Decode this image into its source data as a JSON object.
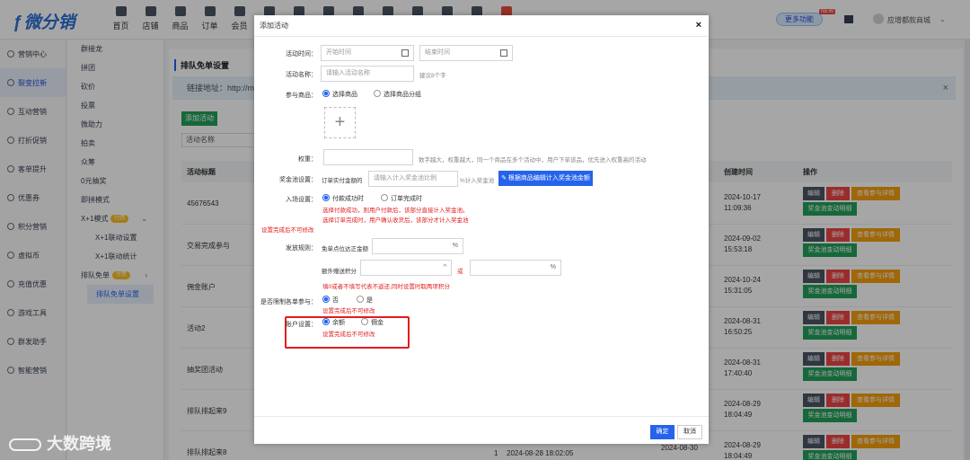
{
  "app": {
    "logo": "微分销"
  },
  "topnav": [
    {
      "label": "首页",
      "icon": "home-icon"
    },
    {
      "label": "店铺",
      "icon": "shop-icon"
    },
    {
      "label": "商品",
      "icon": "goods-icon"
    },
    {
      "label": "订单",
      "icon": "order-icon"
    },
    {
      "label": "会员",
      "icon": "member-icon"
    },
    {
      "label": "",
      "icon": "apps-icon"
    },
    {
      "label": "",
      "icon": "gift-icon"
    },
    {
      "label": "",
      "icon": "chart-icon"
    },
    {
      "label": "",
      "icon": "gear-icon"
    },
    {
      "label": "",
      "icon": "share-icon"
    },
    {
      "label": "",
      "icon": "compass-icon"
    },
    {
      "label": "",
      "icon": "graduation-icon"
    },
    {
      "label": "",
      "icon": "pie-icon"
    },
    {
      "label": "",
      "icon": "badge-icon"
    }
  ],
  "header": {
    "more": "更多功能",
    "new_badge": "NEW",
    "user": "应增都款商城"
  },
  "sidebar": [
    "营销中心",
    "裂变拉新",
    "互动营销",
    "打折促销",
    "客单提升",
    "优惠券",
    "积分营销",
    "虚拟币",
    "充值优惠",
    "游戏工具",
    "群发助手",
    "智能营销"
  ],
  "sidebar_active": 1,
  "subnav": {
    "items": [
      "群接龙",
      "拼团",
      "砍价",
      "投票",
      "微助力",
      "拍卖",
      "众筹",
      "0元抽奖",
      "即拼模式"
    ],
    "x1": "X+1模式",
    "x1_tag": "付费",
    "x1_children": [
      "X+1联动设置",
      "X+1联动统计"
    ],
    "queue": "排队免单",
    "queue_tag": "付费",
    "queue_child": "排队免单设置"
  },
  "main": {
    "title": "排队免单设置",
    "link_label": "链接地址：http://m",
    "add_button": "添加活动",
    "search_placeholder": "活动名称",
    "columns": {
      "title": "活动标题",
      "created": "创建时间",
      "ops": "操作"
    },
    "ops": {
      "edit": "编辑",
      "delete": "删除",
      "view": "查看参与详情",
      "detail": "奖金池变动明细"
    },
    "rows": [
      {
        "title": "45676543",
        "date": "2024-10-17",
        "time": "11:09:36"
      },
      {
        "title": "交易完成参与",
        "date": "2024-09-02",
        "time": "15:53:18"
      },
      {
        "title": "佣金账户",
        "date": "2024-10-24",
        "time": "15:31:05"
      },
      {
        "title": "活动2",
        "date": "2024-08-31",
        "time": "16:50:25"
      },
      {
        "title": "抽奖团活动",
        "date": "2024-08-31",
        "time": "17:40:40"
      },
      {
        "title": "排队排起来9",
        "date": "2024-08-29",
        "time": "18:04:49"
      },
      {
        "title": "排队排起来8",
        "date": "2024-08-29",
        "time": "18:04:49",
        "extra_count": "1",
        "extra_start": "2024-08-28 18:02:05",
        "extra_end": "2024-08-30"
      }
    ]
  },
  "modal": {
    "title": "添加活动",
    "close": "×",
    "fields": {
      "time_label": "活动时间：",
      "start_ph": "开始时间",
      "end_ph": "结束时间",
      "name_label": "活动名称：",
      "name_ph": "请输入活动名称",
      "name_hint": "建议8个字",
      "goods_label": "参与商品：",
      "goods_opt1": "选择商品",
      "goods_opt2": "选择商品分组",
      "upload_plus": "+",
      "weight_label": "权重：",
      "weight_hint": "数字越大，权重越大，同一个商品在多个活动中，用户下单该品，优先进入权重高的活动",
      "pool_label": "奖金池设置：",
      "pool_prefix": "订单实付金额的",
      "pool_ph": "请输入计入奖金池比例",
      "pool_unit": "%计入奖金池",
      "pool_button": "根据商品编辑计入奖金池金额",
      "entry_label": "入场设置：",
      "entry_opt1": "付款成功时",
      "entry_opt2": "订单完成时",
      "entry_note1": "选择付款成功，则用户付款后，该部分直接计入奖金池。",
      "entry_note2": "选择订单完成时，用户确认收货后，该部分才计入奖金池",
      "entry_locked": "设置完成后不可修改",
      "issue_label": "发放规则：",
      "issue_prefix": "免单点位达正金额",
      "pct": "%",
      "extra_label": "额外赠送积分",
      "or": "或",
      "issue_note": "填0或者不填写代表不返还,同时设置时取两项积分",
      "limit_label": "是否限制各单参与：",
      "limit_no": "否",
      "limit_yes": "是",
      "limit_locked": "设置完成后不可修改",
      "account_label": "账户设置：",
      "account_balance": "余额",
      "account_commission": "佣金",
      "account_locked": "设置完成后不可修改"
    },
    "ok": "确定",
    "cancel": "取消"
  },
  "watermark": "大数跨境",
  "colors": {
    "primary": "#2563eb",
    "success": "#22a05a",
    "danger": "#ef4444",
    "warning": "#f59e0b",
    "highlight": "#e11d1d"
  }
}
